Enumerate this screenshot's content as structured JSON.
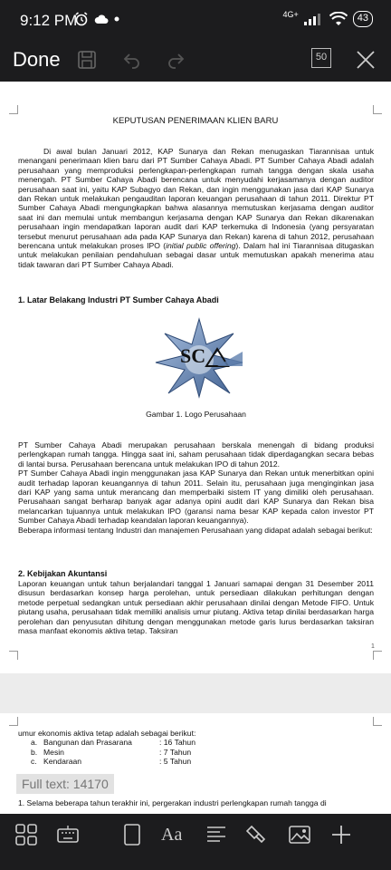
{
  "status_bar": {
    "time": "9:12 PM",
    "network": "4G+",
    "battery": "43"
  },
  "toolbar": {
    "done_label": "Done",
    "page_count": "50"
  },
  "document": {
    "title": "KEPUTUSAN PENERIMAAN KLIEN BARU",
    "intro": "Di awal bulan Januari 2012, KAP Sunarya dan Rekan menugaskan Tiarannisaa untuk menangani penerimaan klien baru dari PT Sumber Cahaya Abadi. PT Sumber Cahaya Abadi adalah perusahaan yang memproduksi perlengkapan-perlengkapan rumah tangga dengan skala usaha menengah. PT Sumber Cahaya Abadi berencana untuk menyudahi kerjasamanya dengan auditor perusahaan saat ini, yaitu KAP Subagyo dan Rekan, dan ingin menggunakan jasa dari KAP Sunarya dan Rekan untuk melakukan pengauditan laporan keuangan perusahaan di tahun 2011. Direktur PT Sumber Cahaya Abadi mengungkapkan bahwa alasannya memutuskan kerjasama dengan auditor saat ini dan memulai untuk membangun kerjasama dengan KAP Sunarya dan Rekan dikarenakan perusahaan ingin mendapatkan laporan audit dari KAP terkemuka di Indonesia (yang persyaratan tersebut menurut perusahaan ada pada KAP Sunarya dan Rekan) karena di tahun 2012, perusahaan berencana untuk melakukan proses IPO (",
    "intro_italic": "initial public offering",
    "intro_end": "). Dalam hal ini Tiarannisaa ditugaskan untuk melakukan penilaian pendahuluan sebagai dasar untuk memutuskan apakah menerima atau tidak tawaran dari PT Sumber Cahaya Abadi.",
    "section1_heading": "1.  Latar Belakang Industri PT Sumber Cahaya Abadi",
    "logo_text": "SC",
    "figure_caption": "Gambar 1. Logo Perusahaan",
    "para2": "PT Sumber Cahaya Abadi merupakan perusahaan berskala menengah di bidang produksi perlengkapan rumah tangga. Hingga saat ini, saham perusahaan tidak diperdagangkan secara bebas di lantai bursa. Perusahaan berencana untuk melakukan IPO di tahun 2012.",
    "para3": "PT Sumber Cahaya Abadi ingin menggunakan jasa KAP Sunarya dan Rekan untuk menerbitkan opini audit terhadap laporan keuangannya di tahun 2011. Selain itu, perusahaan juga menginginkan jasa dari KAP yang sama untuk merancang dan memperbaiki sistem IT yang dimiliki oleh perusahaan. Perusahaan sangat berharap banyak agar adanya opini audit dari KAP Sunarya dan Rekan bisa melancarkan tujuannya untuk melakukan IPO (garansi nama besar KAP kepada calon investor PT Sumber Cahaya Abadi terhadap keandalan laporan keuangannya).",
    "para4": "Beberapa informasi tentang Industri dan manajemen Perusahaan yang didapat adalah sebagai berikut:",
    "section2_heading": "2.  Kebijakan Akuntansi",
    "para5": "Laporan keuangan untuk tahun berjalandari tanggal 1 Januari samapai dengan 31 Desember 2011 disusun berdasarkan konsep harga perolehan, untuk persediaan dilakukan perhitungan dengan metode perpetual sedangkan untuk persediaan akhir perusahaan dinilai dengan Metode FIFO. Untuk piutang usaha, perusahaan tidak memiliki analisis umur piutang. Aktiva tetap dinilai berdasarkan harga perolehan dan penyusutan dihitung dengan menggunakan metode garis lurus berdasarkan taksiran masa manfaat ekonomis aktiva tetap. Taksiran",
    "page_number": "1",
    "page2_lead": "umur ekonomis aktiva tetap adalah sebagai berikut:",
    "assets": [
      {
        "letter": "a.",
        "name": "Bangunan dan Prasarana",
        "value": ": 16 Tahun"
      },
      {
        "letter": "b.",
        "name": "Mesin",
        "value": ": 7 Tahun"
      },
      {
        "letter": "c.",
        "name": "Kendaraan",
        "value": ": 5 Tahun"
      }
    ],
    "page2_next": "1.   Selama beberapa tahun terakhir ini, pergerakan industri perlengkapan rumah tangga di"
  },
  "full_text_badge": "Full text: 14170",
  "bottom_bar": {
    "icons": [
      "layout-icon",
      "keyboard-icon",
      "page-icon",
      "font-icon",
      "paragraph-icon",
      "format-painter-icon",
      "image-icon",
      "add-icon"
    ]
  },
  "colors": {
    "chrome": "#1c1c1e",
    "page": "#ffffff",
    "background": "#ececec",
    "logo_blue": "#5f7fae"
  }
}
